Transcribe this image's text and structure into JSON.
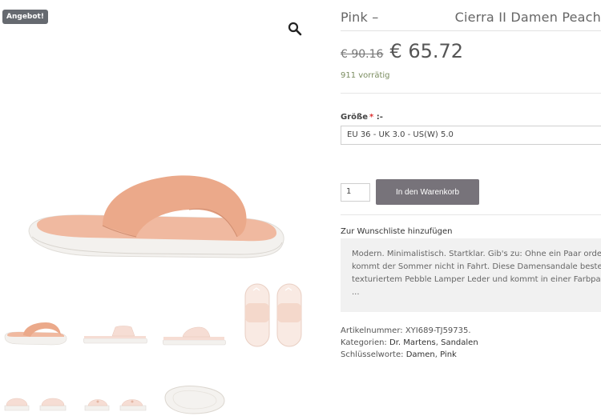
{
  "gallery": {
    "sale_badge": "Angebot!",
    "zoom_icon": "magnifier-icon"
  },
  "product": {
    "title_left": "Pink –",
    "title_right": "Cierra II Damen Peach",
    "old_price": "€ 90.16",
    "new_price": "€ 65.72",
    "stock": "911 vorrätig",
    "size_label": "Größe",
    "size_required_mark": "*",
    "size_label_suffix": ":-",
    "size_selected": "EU 36 - UK 3.0 - US(W) 5.0",
    "quantity": "1",
    "add_to_cart": "In den Warenkorb",
    "wishlist": "Zur Wunschliste hinzufügen",
    "description_lines": [
      "Modern. Minimalistisch. Startklar. Gib's zu: Ohne ein Paar ordentli",
      "kommt der Sommer nicht in Fahrt. Diese Damensandale besteht a",
      "texturiertem Pebble Lamper Leder und kommt in einer Farbpalett",
      "..."
    ],
    "sku_label": "Artikelnummer:",
    "sku": "XYI689-TJ59735.",
    "categories_label": "Kategorien:",
    "categories": [
      "Dr. Martens",
      "Sandalen"
    ],
    "tags_label": "Schlüsselworte:",
    "tags": [
      "Damen",
      "Pink"
    ]
  },
  "colors": {
    "sandal_strap": "#eba98a",
    "sandal_bed": "#f0b9a0",
    "sole": "#f4f2ef",
    "pale_pink": "#f6ddd4",
    "button": "#77737a",
    "badge": "#666a70"
  }
}
